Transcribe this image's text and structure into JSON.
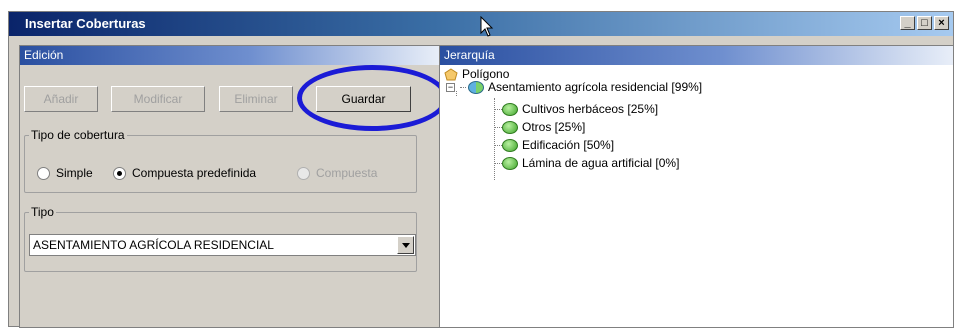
{
  "window": {
    "title": "Insertar Coberturas",
    "controls": [
      "_",
      "□",
      "×"
    ]
  },
  "left_panel": {
    "header": "Edición",
    "buttons": {
      "add": "Añadir",
      "modify": "Modificar",
      "delete": "Eliminar",
      "save": "Guardar"
    },
    "coverage_type": {
      "legend": "Tipo de cobertura",
      "options": [
        {
          "label": "Simple",
          "checked": false,
          "enabled": true
        },
        {
          "label": "Compuesta predefinida",
          "checked": true,
          "enabled": true
        },
        {
          "label": "Compuesta",
          "checked": false,
          "enabled": false
        }
      ]
    },
    "type_group": {
      "legend": "Tipo",
      "selected": "ASENTAMIENTO AGRÍCOLA RESIDENCIAL"
    }
  },
  "right_panel": {
    "header": "Jerarquía",
    "tree": {
      "root": "Polígono",
      "node": "Asentamiento agrícola residencial [99%]",
      "children": [
        "Cultivos herbáceos [25%]",
        "Otros [25%]",
        "Edificación [50%]",
        "Lámina de agua artificial [0%]"
      ]
    }
  },
  "colors": {
    "title_bar": "#0a246a",
    "highlight_ellipse": "#1b1bd6",
    "node_green": "#3fa52a",
    "root_yellow": "#f5c86a"
  }
}
